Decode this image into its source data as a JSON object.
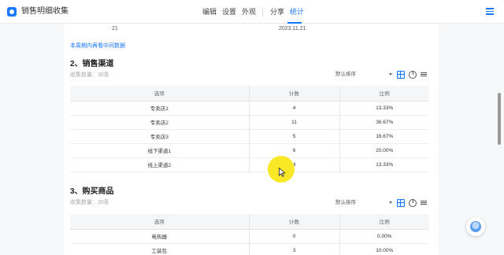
{
  "header": {
    "app_title": "销售明细收集",
    "tabs": [
      {
        "label": "编辑"
      },
      {
        "label": "设置"
      },
      {
        "label": "外观"
      },
      {
        "label": "分享"
      },
      {
        "label": "统计"
      }
    ],
    "active_tab": "统计"
  },
  "top_row": {
    "value_left": "21",
    "value_right": "2023.11.21"
  },
  "link_text": "本周期内再看中间数据",
  "section2": {
    "title": "2、销售渠道",
    "subtitle": "收集数量：30条",
    "sort_label": "默认排序",
    "columns": [
      "选项",
      "计数",
      "比例"
    ],
    "rows": [
      {
        "option": "专卖店1",
        "count": "4",
        "ratio": "13.33%"
      },
      {
        "option": "专卖店2",
        "count": "11",
        "ratio": "36.67%"
      },
      {
        "option": "专卖店3",
        "count": "5",
        "ratio": "16.67%"
      },
      {
        "option": "线下渠道1",
        "count": "6",
        "ratio": "20.00%"
      },
      {
        "option": "线上渠道2",
        "count": "4",
        "ratio": "13.33%"
      }
    ]
  },
  "section3": {
    "title": "3、购买商品",
    "subtitle": "收集数量：30条",
    "sort_label": "默认排序",
    "columns": [
      "选项",
      "计数",
      "比例"
    ],
    "rows": [
      {
        "option": "电热器",
        "count": "0",
        "ratio": "0.00%"
      },
      {
        "option": "工装包",
        "count": "3",
        "ratio": "10.00%"
      }
    ]
  },
  "icons": {
    "table_view": "grid-icon",
    "pie_view": "pie-chart-icon",
    "bar_view": "bar-list-icon",
    "menu": "hamburger-menu-icon"
  },
  "colors": {
    "accent": "#1677ff",
    "cursor_highlight": "#fae614"
  }
}
